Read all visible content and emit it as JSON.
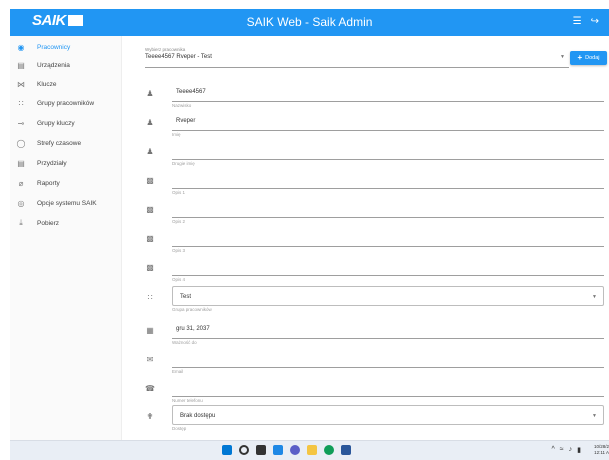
{
  "header": {
    "logo_text": "SAIK",
    "title": "SAIK Web - Saik Admin",
    "bg_color": "#2196f3"
  },
  "sidebar": {
    "items": [
      {
        "label": "Pracownicy",
        "icon": "account-circle-icon",
        "active": true
      },
      {
        "label": "Urządzenia",
        "icon": "device-icon"
      },
      {
        "label": "Klucze",
        "icon": "key-icon"
      },
      {
        "label": "Grupy pracowników",
        "icon": "group-icon"
      },
      {
        "label": "Grupy kluczy",
        "icon": "key-group-icon"
      },
      {
        "label": "Strefy czasowe",
        "icon": "clock-icon"
      },
      {
        "label": "Przydziały",
        "icon": "assignment-icon"
      },
      {
        "label": "Raporty",
        "icon": "report-icon"
      },
      {
        "label": "Opcje systemu SAIK",
        "icon": "settings-icon"
      },
      {
        "label": "Pobierz",
        "icon": "download-icon"
      }
    ]
  },
  "selector": {
    "label": "Wybierz pracownika",
    "value": "Teeee4567 Rveper - Test"
  },
  "add_button": {
    "label": "Dodaj"
  },
  "fields": [
    {
      "icon": "person-icon",
      "value": "Teeee4567",
      "label": "Nazwisko"
    },
    {
      "icon": "person-icon",
      "value": "Rveper",
      "label": "Imię"
    },
    {
      "icon": "person-icon",
      "value": "",
      "label": "Drugie imię"
    },
    {
      "icon": "document-icon",
      "value": "",
      "label": "Opis 1"
    },
    {
      "icon": "document-icon",
      "value": "",
      "label": "Opis 2"
    },
    {
      "icon": "document-icon",
      "value": "",
      "label": "Opis 3"
    },
    {
      "icon": "document-icon",
      "value": "",
      "label": "Opis 4"
    },
    {
      "icon": "group-icon",
      "value": "Test",
      "label": "Grupa pracowników",
      "dropdown": true
    },
    {
      "icon": "calendar-icon",
      "value": "gru 31, 2037",
      "label": "Ważność do"
    },
    {
      "icon": "email-icon",
      "value": "",
      "label": "Email"
    },
    {
      "icon": "phone-icon",
      "value": "",
      "label": "Numer telefonu"
    },
    {
      "icon": "accessibility-icon",
      "value": "Brak dostępu",
      "label": "Dostęp",
      "dropdown": true
    }
  ],
  "taskbar": {
    "apps": [
      {
        "icon": "windows-start-icon",
        "color": "#0078d4"
      },
      {
        "icon": "search-icon",
        "color": "#333333"
      },
      {
        "icon": "task-view-icon",
        "color": "#333333"
      },
      {
        "icon": "widgets-icon",
        "color": "#1e88e5"
      },
      {
        "icon": "chat-icon",
        "color": "#5b5fc7"
      },
      {
        "icon": "file-explorer-icon",
        "color": "#f4c542"
      },
      {
        "icon": "edge-icon",
        "color": "#0f9d58"
      },
      {
        "icon": "store-icon",
        "color": "#2b579a"
      }
    ],
    "clock_time": "10/28/2",
    "clock_date": "12:11 A"
  }
}
